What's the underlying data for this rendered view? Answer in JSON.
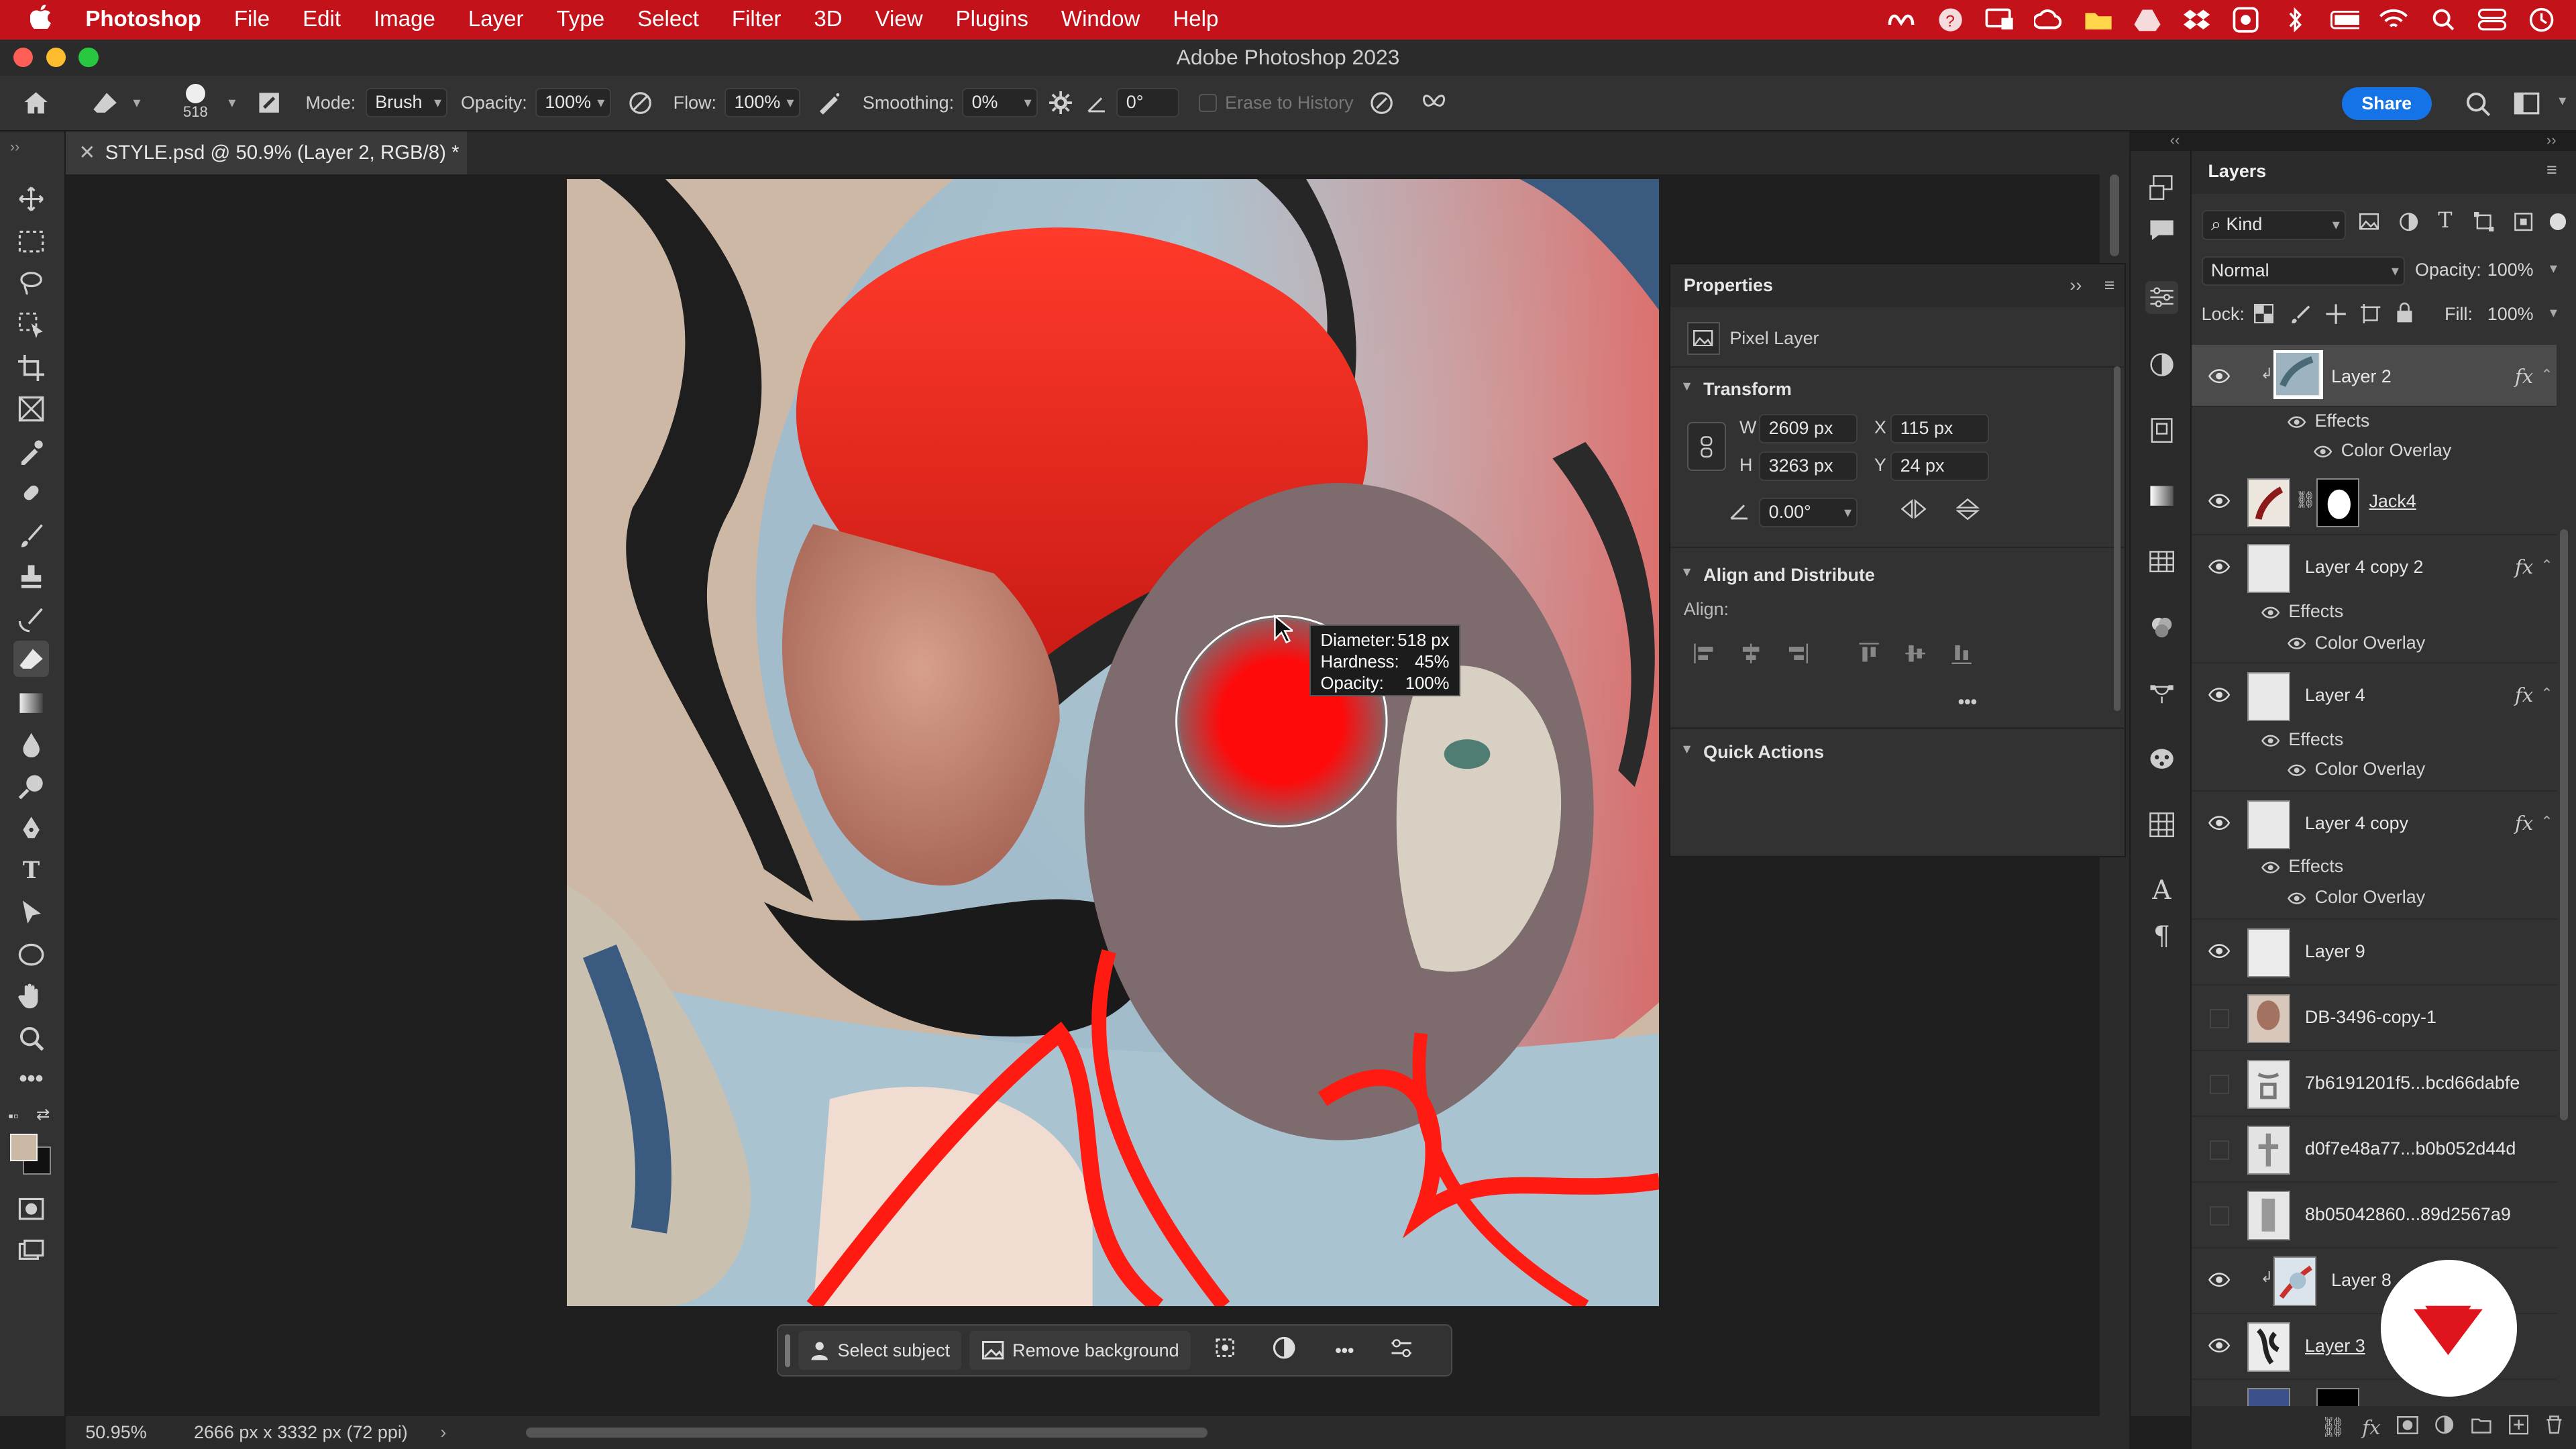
{
  "menubar": {
    "app_name": "Photoshop",
    "items": [
      "File",
      "Edit",
      "Image",
      "Layer",
      "Type",
      "Select",
      "Filter",
      "3D",
      "View",
      "Plugins",
      "Window",
      "Help"
    ],
    "status_icons": [
      "meta-icon",
      "help-icon",
      "screen-icon",
      "creative-cloud-icon",
      "folder-icon",
      "drive-icon",
      "dropbox-icon",
      "screenshot-icon",
      "bluetooth-icon",
      "battery-icon",
      "wifi-icon",
      "search-icon",
      "control-center-icon",
      "siri-icon"
    ]
  },
  "window": {
    "title": "Adobe Photoshop 2023"
  },
  "options_bar": {
    "brush_size": "518",
    "mode_label": "Mode:",
    "mode_value": "Brush",
    "opacity_label": "Opacity:",
    "opacity_value": "100%",
    "flow_label": "Flow:",
    "flow_value": "100%",
    "smoothing_label": "Smoothing:",
    "smoothing_value": "0%",
    "angle_value": "0°",
    "erase_history_label": "Erase to History",
    "share_label": "Share"
  },
  "document_tab": {
    "title": "STYLE.psd @ 50.9% (Layer 2, RGB/8) *"
  },
  "brush_tooltip": {
    "diameter_label": "Diameter:",
    "diameter_value": "518 px",
    "hardness_label": "Hardness:",
    "hardness_value": "45%",
    "opacity_label": "Opacity:",
    "opacity_value": "100%"
  },
  "context_bar": {
    "select_subject": "Select subject",
    "remove_background": "Remove background"
  },
  "status_bar": {
    "zoom": "50.95%",
    "doc_info": "2666 px x 3332 px (72 ppi)"
  },
  "properties": {
    "title": "Properties",
    "layer_type": "Pixel Layer",
    "transform_title": "Transform",
    "w_label": "W",
    "w_value": "2609 px",
    "x_label": "X",
    "x_value": "115 px",
    "h_label": "H",
    "h_value": "3263 px",
    "y_label": "Y",
    "y_value": "24 px",
    "angle_value": "0.00°",
    "align_title": "Align and Distribute",
    "align_label": "Align:",
    "quick_actions_title": "Quick Actions"
  },
  "layers_panel": {
    "title": "Layers",
    "filter_kind": "Kind",
    "blend_mode": "Normal",
    "opacity_label": "Opacity:",
    "opacity_value": "100%",
    "lock_label": "Lock:",
    "fill_label": "Fill:",
    "fill_value": "100%",
    "effects_label": "Effects",
    "color_overlay_label": "Color Overlay",
    "layers": [
      {
        "name": "Layer 2",
        "visible": true,
        "fx": true,
        "selected": true
      },
      {
        "name": "Jack4",
        "visible": true,
        "fx": false
      },
      {
        "name": "Layer 4 copy 2",
        "visible": true,
        "fx": true
      },
      {
        "name": "Layer 4",
        "visible": true,
        "fx": true
      },
      {
        "name": "Layer 4 copy",
        "visible": true,
        "fx": true
      },
      {
        "name": "Layer 9",
        "visible": true,
        "fx": false
      },
      {
        "name": "DB-3496-copy-1",
        "visible": false,
        "fx": false
      },
      {
        "name": "7b6191201f5...bcd66dabfe",
        "visible": false,
        "fx": false
      },
      {
        "name": "d0f7e48a77...b0b052d44d",
        "visible": false,
        "fx": false
      },
      {
        "name": "8b05042860...89d2567a9",
        "visible": false,
        "fx": false
      },
      {
        "name": "Layer 8",
        "visible": true,
        "fx": false
      },
      {
        "name": "Layer 3",
        "visible": true,
        "fx": false
      }
    ]
  },
  "colors": {
    "menubar_red": "#c4121a",
    "accent_blue": "#1473e6",
    "brush_red": "#ff0a0a"
  }
}
